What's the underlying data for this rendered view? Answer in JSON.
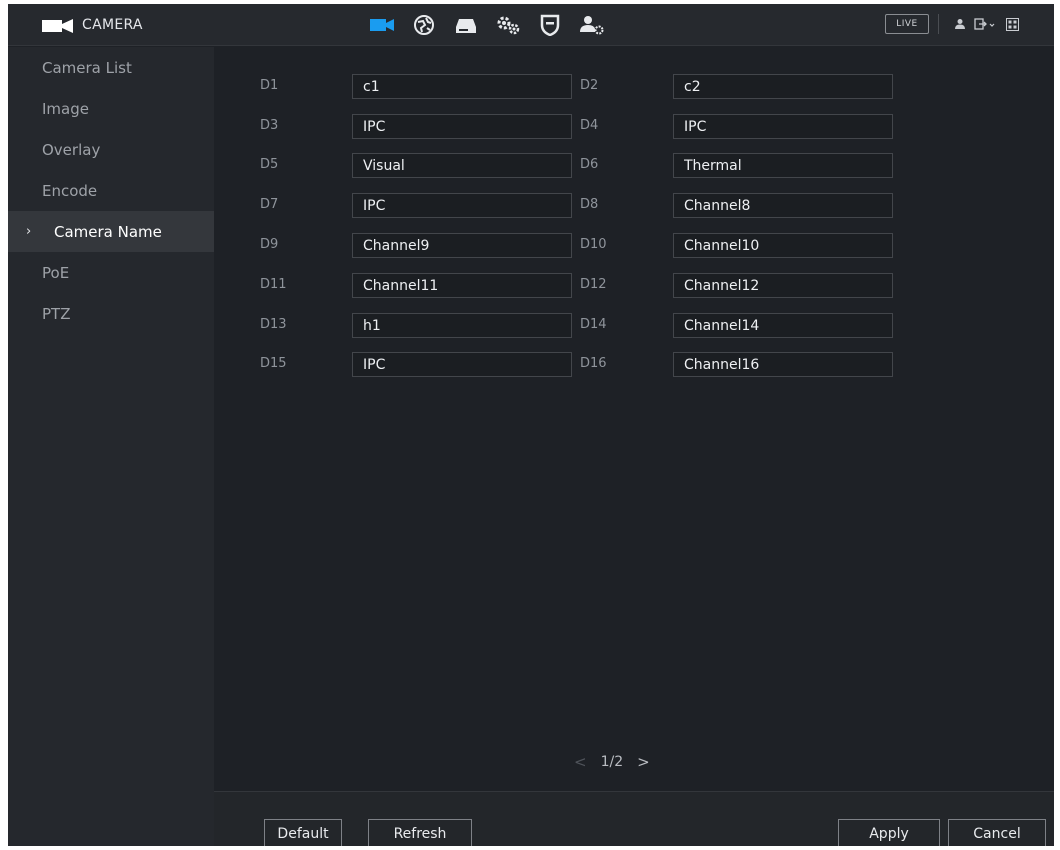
{
  "app": {
    "title": "CAMERA"
  },
  "topbar": {
    "nav_icons": [
      "camera-icon",
      "network-globe-icon",
      "storage-icon",
      "system-gears-icon",
      "security-shield-icon",
      "account-icon"
    ],
    "live_label": "LIVE",
    "right_icons": [
      "user-icon",
      "logout-icon",
      "grid-menu-icon"
    ]
  },
  "sidebar": {
    "items": [
      {
        "label": "Camera List"
      },
      {
        "label": "Image"
      },
      {
        "label": "Overlay"
      },
      {
        "label": "Encode"
      },
      {
        "label": "Camera Name",
        "active": true
      },
      {
        "label": "PoE"
      },
      {
        "label": "PTZ"
      }
    ]
  },
  "channels": [
    {
      "left": {
        "label": "D1",
        "value": "c1"
      },
      "right": {
        "label": "D2",
        "value": "c2"
      }
    },
    {
      "left": {
        "label": "D3",
        "value": "IPC"
      },
      "right": {
        "label": "D4",
        "value": "IPC"
      }
    },
    {
      "left": {
        "label": "D5",
        "value": "Visual"
      },
      "right": {
        "label": "D6",
        "value": "Thermal"
      }
    },
    {
      "left": {
        "label": "D7",
        "value": "IPC"
      },
      "right": {
        "label": "D8",
        "value": "Channel8"
      }
    },
    {
      "left": {
        "label": "D9",
        "value": "Channel9"
      },
      "right": {
        "label": "D10",
        "value": "Channel10"
      }
    },
    {
      "left": {
        "label": "D11",
        "value": "Channel11"
      },
      "right": {
        "label": "D12",
        "value": "Channel12"
      }
    },
    {
      "left": {
        "label": "D13",
        "value": "h1"
      },
      "right": {
        "label": "D14",
        "value": "Channel14"
      }
    },
    {
      "left": {
        "label": "D15",
        "value": "IPC"
      },
      "right": {
        "label": "D16",
        "value": "Channel16"
      }
    }
  ],
  "pager": {
    "prev": "<",
    "page": "1/2",
    "next": ">"
  },
  "footer": {
    "default_label": "Default",
    "refresh_label": "Refresh",
    "apply_label": "Apply",
    "cancel_label": "Cancel"
  },
  "colors": {
    "background": "#1e2126",
    "sidebar": "#25282d",
    "accent": "#1a9cf0"
  }
}
